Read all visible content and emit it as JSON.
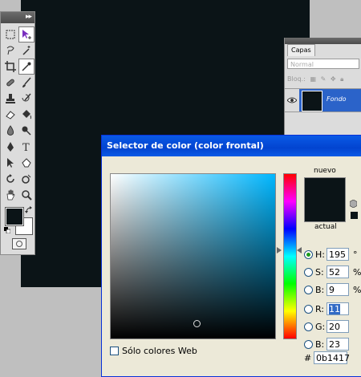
{
  "layers_panel": {
    "tab_label": "Capas",
    "blend_mode": "Normal",
    "lock_label": "Bloq.:",
    "layer_name": "Fondo"
  },
  "dialog": {
    "title": "Selector de color (color frontal)",
    "new_label": "nuevo",
    "current_label": "actual",
    "fields": {
      "H": {
        "label": "H:",
        "value": "195",
        "unit": "°"
      },
      "S": {
        "label": "S:",
        "value": "52",
        "unit": "%"
      },
      "Bv": {
        "label": "B:",
        "value": "9",
        "unit": "%"
      },
      "R": {
        "label": "R:",
        "value": "11"
      },
      "G": {
        "label": "G:",
        "value": "20"
      },
      "B": {
        "label": "B:",
        "value": "23"
      }
    },
    "hex_prefix": "#",
    "hex": "0b1417",
    "web_only_label": "Sólo colores Web"
  },
  "colors": {
    "foreground": "#0b1417",
    "background": "#ffffff",
    "hue_base": "#00b7ff"
  },
  "icons": [
    "marquee-icon",
    "move-icon",
    "lasso-icon",
    "magic-wand-icon",
    "crop-icon",
    "eyedropper-icon",
    "healing-brush-icon",
    "brush-icon",
    "stamp-icon",
    "history-brush-icon",
    "eraser-icon",
    "paint-bucket-icon",
    "blur-icon",
    "dodge-icon",
    "pen-icon",
    "type-icon",
    "path-select-icon",
    "shape-icon",
    "rotate-icon",
    "3d-icon",
    "hand-icon",
    "zoom-icon"
  ]
}
